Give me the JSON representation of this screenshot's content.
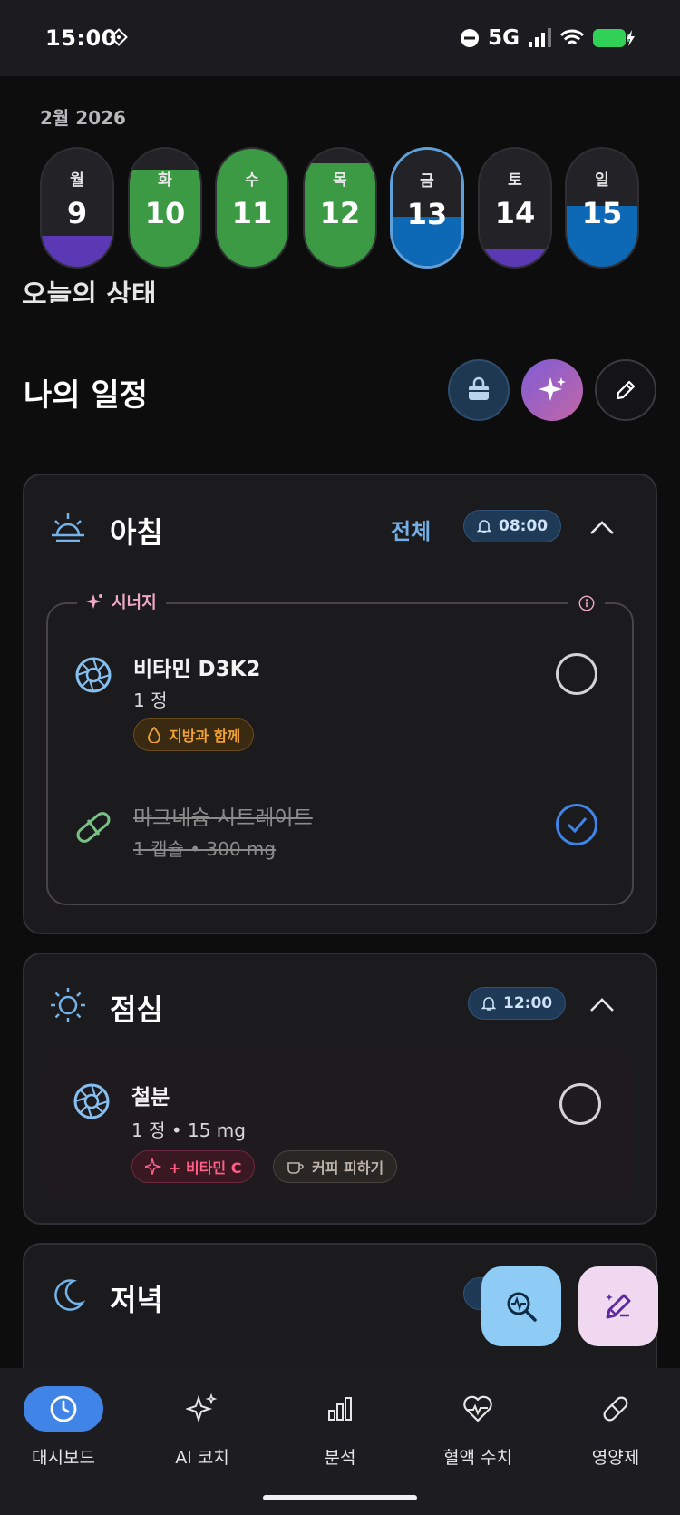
{
  "status_bar": {
    "time": "15:00",
    "network": "5G"
  },
  "calendar": {
    "month": "2월 2026",
    "days": [
      {
        "name": "월",
        "num": "9",
        "fill_color": "#5b39b5",
        "fill_fraction": 0.25
      },
      {
        "name": "화",
        "num": "10",
        "fill_color": "#3c9a44",
        "fill_fraction": 0.8
      },
      {
        "name": "수",
        "num": "11",
        "fill_color": "#3c9a44",
        "fill_fraction": 1.0
      },
      {
        "name": "목",
        "num": "12",
        "fill_color": "#3c9a44",
        "fill_fraction": 0.85
      },
      {
        "name": "금",
        "num": "13",
        "fill_color": "#0d69b5",
        "fill_fraction": 0.4,
        "selected": true
      },
      {
        "name": "토",
        "num": "14",
        "fill_color": "#5b39b5",
        "fill_fraction": 0.15
      },
      {
        "name": "일",
        "num": "15",
        "fill_color": "#0d69b5",
        "fill_fraction": 0.5
      }
    ]
  },
  "peek_text": "오늘의 상태",
  "schedule": {
    "title": "나의 일정"
  },
  "morning": {
    "title": "아침",
    "all_label": "전체",
    "time": "08:00",
    "synergy_label": "시너지",
    "items": [
      {
        "name": "비타민 D3K2",
        "detail": "1 정",
        "chip": "지방과 함께",
        "done": false
      },
      {
        "name": "마그네슘 시트레이트",
        "detail": "1 캡슐 • 300 mg",
        "done": true
      }
    ]
  },
  "lunch": {
    "title": "점심",
    "time": "12:00",
    "items": [
      {
        "name": "철분",
        "detail": "1 정 • 15 mg",
        "chips": [
          "+ 비타민 C",
          "커피 피하기"
        ],
        "done": false
      }
    ]
  },
  "dinner": {
    "title": "저녁"
  },
  "nav": [
    {
      "label": "대시보드",
      "icon": "clock-icon",
      "active": true
    },
    {
      "label": "AI 코치",
      "icon": "sparkles-icon",
      "active": false
    },
    {
      "label": "분석",
      "icon": "bar-chart-icon",
      "active": false
    },
    {
      "label": "혈액 수치",
      "icon": "heart-pulse-icon",
      "active": false
    },
    {
      "label": "영양제",
      "icon": "pill-icon",
      "active": false
    }
  ],
  "colors": {
    "accent": "#3f84e6",
    "green": "#3c9a44",
    "purple": "#5b39b5",
    "blue": "#0d69b5"
  }
}
